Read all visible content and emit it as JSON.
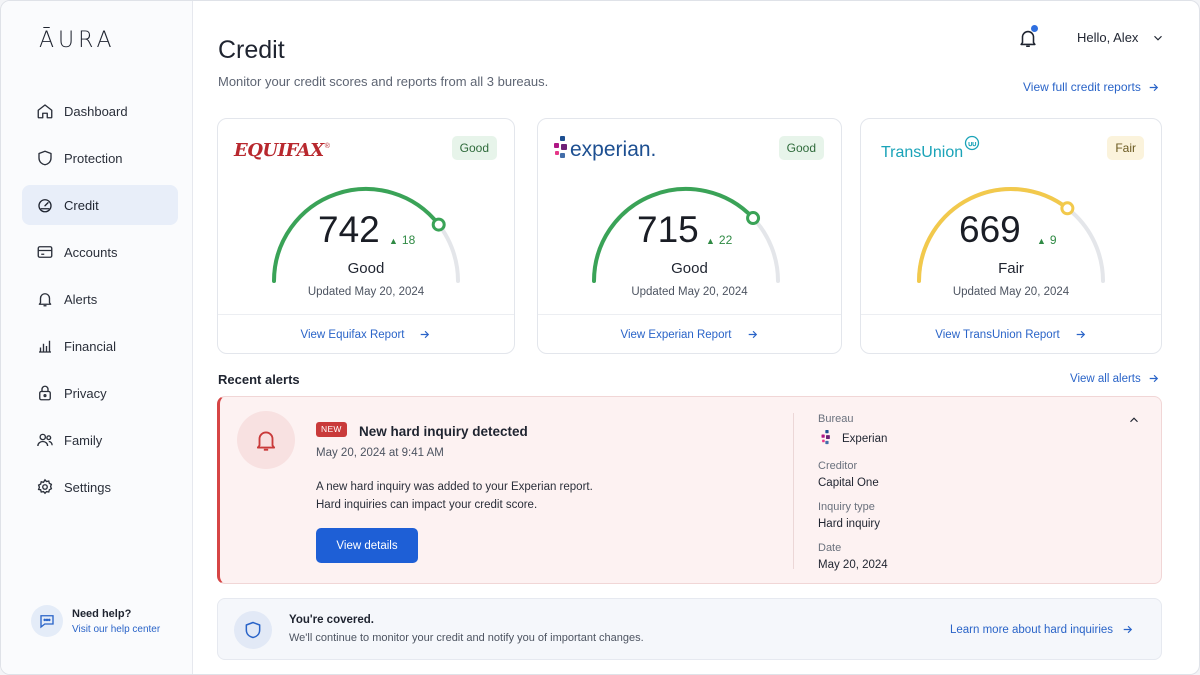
{
  "app": {
    "logo": "ĀURA"
  },
  "sidebar": {
    "items": [
      {
        "label": "Dashboard",
        "icon": "home-icon",
        "active": false
      },
      {
        "label": "Protection",
        "icon": "shield-icon",
        "active": false
      },
      {
        "label": "Credit",
        "icon": "gauge-icon",
        "active": true
      },
      {
        "label": "Accounts",
        "icon": "card-icon",
        "active": false
      },
      {
        "label": "Alerts",
        "icon": "bell-icon",
        "active": false
      },
      {
        "label": "Financial",
        "icon": "bar-chart-icon",
        "active": false
      },
      {
        "label": "Privacy",
        "icon": "lock-icon",
        "active": false
      },
      {
        "label": "Family",
        "icon": "people-icon",
        "active": false
      },
      {
        "label": "Settings",
        "icon": "gear-icon",
        "active": false
      }
    ],
    "help": {
      "title": "Need help?",
      "link": "Visit our help center"
    }
  },
  "header": {
    "title": "Credit",
    "subtitle": "Monitor your credit scores and reports from all 3 bureaus.",
    "greeting": "Hello, Alex",
    "full_reports_link": "View full credit reports"
  },
  "bureaus": [
    {
      "name": "EQUIFAX",
      "badge": "Good",
      "score": "742",
      "delta": "18",
      "score_value": 742,
      "gauge_fraction": 0.79,
      "rating": "Good",
      "updated": "Updated May 20, 2024",
      "link": "View Equifax Report",
      "color": "#3aa357"
    },
    {
      "name": "experian.",
      "badge": "Good",
      "score": "715",
      "delta": "22",
      "score_value": 715,
      "gauge_fraction": 0.76,
      "rating": "Good",
      "updated": "Updated May 20, 2024",
      "link": "View Experian Report",
      "color": "#3aa357"
    },
    {
      "name": "TransUnion",
      "badge": "Fair",
      "score": "669",
      "delta": "9",
      "score_value": 669,
      "gauge_fraction": 0.71,
      "rating": "Fair",
      "updated": "Updated May 20, 2024",
      "link": "View TransUnion Report",
      "color": "#f2c94c"
    }
  ],
  "alerts": {
    "section_title": "Recent alerts",
    "view_all": "View all alerts",
    "item": {
      "badge": "NEW",
      "title": "New hard inquiry detected",
      "time": "May 20, 2024 at 9:41 AM",
      "desc_line1": "A new hard inquiry was added to your Experian report.",
      "desc_line2": "Hard inquiries can impact your credit score.",
      "button": "View details",
      "meta": {
        "bureau_label": "Bureau",
        "bureau_value": "Experian",
        "creditor_label": "Creditor",
        "creditor_value": "Capital One",
        "type_label": "Inquiry type",
        "type_value": "Hard inquiry",
        "date_label": "Date",
        "date_value": "May 20, 2024"
      }
    }
  },
  "covered": {
    "title": "You're covered.",
    "text": "We'll continue to monitor your credit and notify you of important changes.",
    "link": "Learn more about hard inquiries"
  },
  "colors": {
    "accent": "#1e5fd6",
    "link": "#2a64c8",
    "good": "#3aa357",
    "fair": "#f2c94c",
    "alert": "#d64545"
  }
}
